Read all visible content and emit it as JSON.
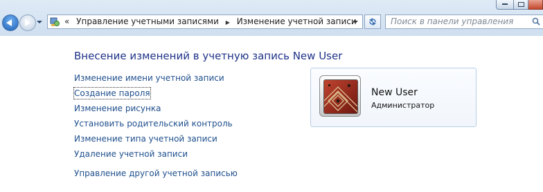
{
  "breadcrumb": {
    "overflow": "«",
    "items": [
      "Управление учетными записями",
      "Изменение учетной записи"
    ]
  },
  "search": {
    "placeholder": "Поиск в панели управления"
  },
  "content": {
    "heading": "Внесение изменений в учетную запись New User",
    "tasks": [
      "Изменение имени учетной записи",
      "Создание пароля",
      "Изменение рисунка",
      "Установить родительский контроль",
      "Изменение типа учетной записи",
      "Удаление учетной записи",
      "Управление другой учетной записью"
    ]
  },
  "user_card": {
    "name": "New User",
    "role": "Администратор"
  },
  "colors": {
    "link": "#1e4e8c",
    "heading": "#1e3287",
    "chrome": "#dfeaf6"
  },
  "icons": [
    "back-arrow-icon",
    "forward-arrow-icon",
    "control-panel-icon",
    "refresh-icon",
    "search-icon"
  ]
}
